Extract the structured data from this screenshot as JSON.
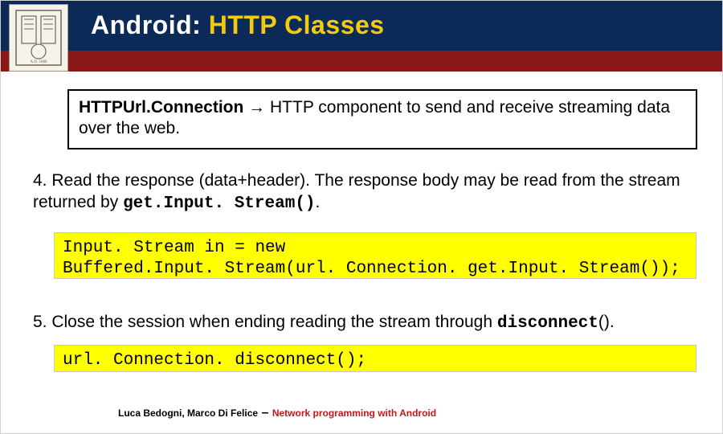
{
  "title": {
    "part1": "Android: ",
    "part2": "HTTP Classes"
  },
  "infoBox": {
    "bold": "HTTPUrl.Connection",
    "arrow": " → ",
    "rest": "HTTP component to send and receive streaming data over the web."
  },
  "step4": {
    "prefix": "4. Read the response (data+header). The response body may be read from the stream  returned by ",
    "mono": "get.Input. Stream()",
    "suffix": "."
  },
  "code1": {
    "line1": "Input. Stream in = new",
    "line2": "Buffered.Input. Stream(url. Connection. get.Input. Stream());"
  },
  "step5": {
    "prefix": "5.  Close the session when ending reading the stream through ",
    "mono": "disconnect",
    "suffix": "()."
  },
  "code2": {
    "line1": "url. Connection. disconnect();"
  },
  "footer": {
    "authors": "Luca Bedogni, Marco Di Felice",
    "dash": " – ",
    "topic": "Network programming with Android"
  }
}
